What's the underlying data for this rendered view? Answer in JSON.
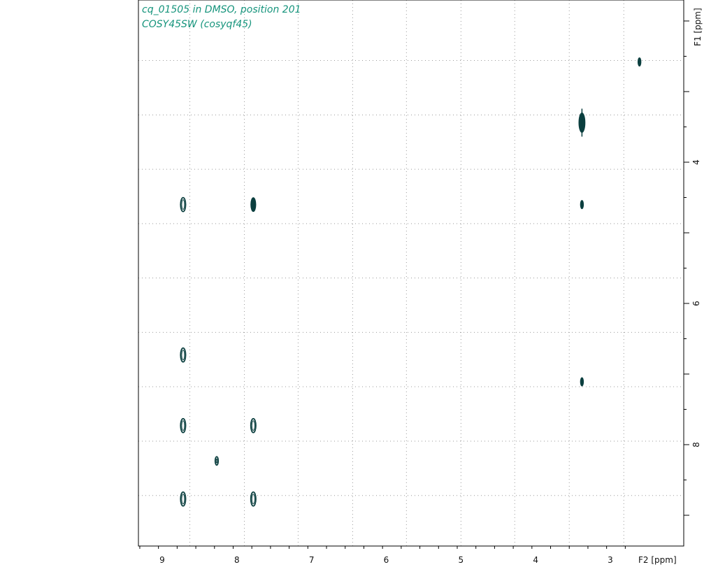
{
  "header": {
    "title": "cq_01505 in DMSO, position 201",
    "subtitle": "COSY45SW (cosyqf45)"
  },
  "colors": {
    "title": "#16947c",
    "contour": "#0b3f3f",
    "grid": "#9a9a9a",
    "axis": "#000000",
    "background": "#ffffff"
  },
  "chart_data": {
    "type": "contour",
    "title": "cq_01505 in DMSO, position 201",
    "subtitle": "COSY45SW (cosyqf45)",
    "x_axis": {
      "label": "F2 [ppm]",
      "range": [
        9.3,
        2.8
      ],
      "reversed": true,
      "ticks": [
        9,
        8,
        7,
        6,
        5,
        4,
        3
      ],
      "tick_labels": [
        "9",
        "8",
        "7",
        "6",
        "5",
        "4",
        "3"
      ],
      "minor_step": 0.25,
      "position": "bottom"
    },
    "y_axis": {
      "label": "F1 [ppm]",
      "range": [
        2.1,
        9.0
      ],
      "reversed": false,
      "ticks": [
        4,
        6,
        8
      ],
      "tick_labels": [
        "4",
        "6",
        "8"
      ],
      "minor_step": 0.5,
      "position": "right"
    },
    "grid": {
      "on": true,
      "style": "dotted",
      "x": [
        8.63,
        7.9,
        7.18,
        6.45,
        5.73,
        5.0,
        4.28,
        3.55,
        2.82
      ],
      "y": [
        2.56,
        3.33,
        4.1,
        4.87,
        5.64,
        6.41,
        7.18,
        7.95,
        8.72
      ]
    },
    "peaks": [
      {
        "f2": 2.61,
        "f1": 2.58,
        "size": "small",
        "kind": "filled"
      },
      {
        "f2": 3.38,
        "f1": 3.44,
        "size": "large",
        "kind": "filled"
      },
      {
        "f2": 3.38,
        "f1": 4.6,
        "size": "small",
        "kind": "filled"
      },
      {
        "f2": 3.38,
        "f1": 7.11,
        "size": "small",
        "kind": "filled"
      },
      {
        "f2": 8.72,
        "f1": 4.6,
        "size": "medium",
        "kind": "ring"
      },
      {
        "f2": 7.78,
        "f1": 4.6,
        "size": "medium",
        "kind": "filled"
      },
      {
        "f2": 8.72,
        "f1": 6.73,
        "size": "medium",
        "kind": "ring"
      },
      {
        "f2": 8.72,
        "f1": 7.73,
        "size": "medium",
        "kind": "ring"
      },
      {
        "f2": 7.78,
        "f1": 7.73,
        "size": "medium",
        "kind": "ring"
      },
      {
        "f2": 8.27,
        "f1": 8.23,
        "size": "small",
        "kind": "ring"
      },
      {
        "f2": 8.72,
        "f1": 8.77,
        "size": "medium",
        "kind": "ring"
      },
      {
        "f2": 7.78,
        "f1": 8.77,
        "size": "medium",
        "kind": "ring"
      }
    ]
  }
}
